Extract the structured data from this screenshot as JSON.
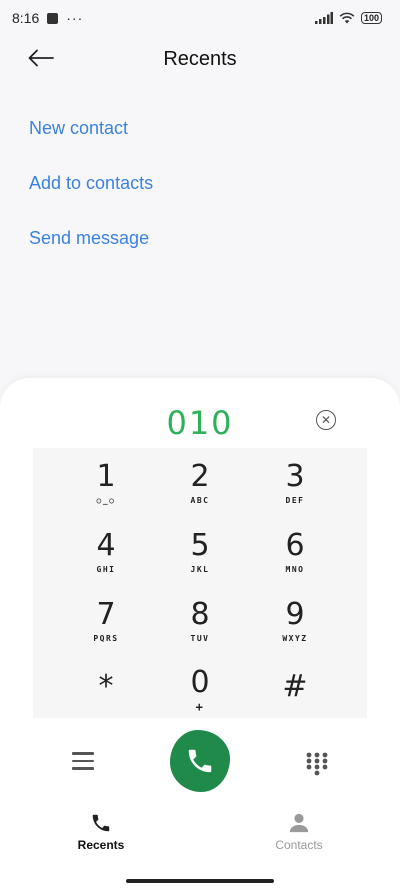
{
  "status_bar": {
    "time": "8:16",
    "notif_dots": "···",
    "battery": "100"
  },
  "header": {
    "title": "Recents"
  },
  "actions": [
    {
      "label": "New contact"
    },
    {
      "label": "Add to contacts"
    },
    {
      "label": "Send message"
    }
  ],
  "dialpad": {
    "number": "010",
    "keys": [
      {
        "digit": "1",
        "letters": "○_○"
      },
      {
        "digit": "2",
        "letters": "ABC"
      },
      {
        "digit": "3",
        "letters": "DEF"
      },
      {
        "digit": "4",
        "letters": "GHI"
      },
      {
        "digit": "5",
        "letters": "JKL"
      },
      {
        "digit": "6",
        "letters": "MNO"
      },
      {
        "digit": "7",
        "letters": "PQRS"
      },
      {
        "digit": "8",
        "letters": "TUV"
      },
      {
        "digit": "9",
        "letters": "WXYZ"
      },
      {
        "digit": "*",
        "letters": ""
      },
      {
        "digit": "0",
        "letters": "+"
      },
      {
        "digit": "#",
        "letters": ""
      }
    ]
  },
  "bottom_nav": {
    "recents": {
      "label": "Recents",
      "active": true
    },
    "contacts": {
      "label": "Contacts",
      "active": false
    }
  },
  "colors": {
    "accent": "#3a82e0",
    "number": "#2fb15a",
    "call": "#1f8a4a",
    "inactive": "#9a9a9a"
  }
}
